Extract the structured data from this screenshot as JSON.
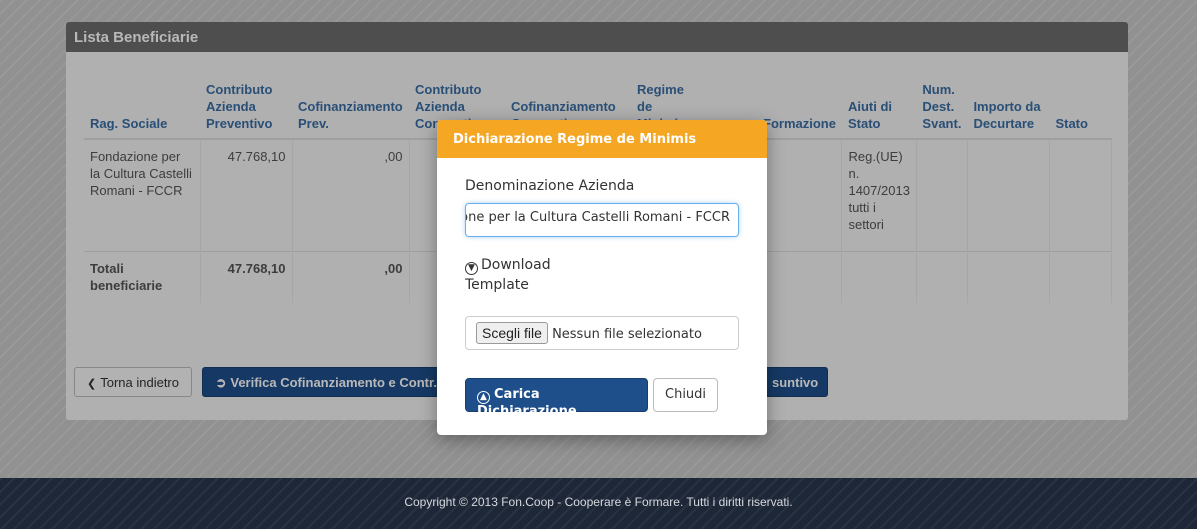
{
  "panel": {
    "title": "Lista Beneficiarie"
  },
  "table": {
    "columns": [
      "Rag. Sociale",
      "Contributo Azienda Preventivo",
      "Cofinanziamento Prev.",
      "Contributo Azienda Consuntivo",
      "Cofinanziamento Consuntivo",
      "Regime de Minimis",
      "",
      "Formazione",
      "Aiuti di Stato",
      "Num. Dest. Svant.",
      "Importo da Decurtare",
      "Stato"
    ],
    "row": {
      "rag_sociale": "Fondazione per la Cultura Castelli Romani - FCCR",
      "contributo": "47.768,10",
      "cofin": ",00",
      "aiuti": "Reg.(UE) n. 1407/2013 tutti i settori"
    },
    "totals": {
      "label": "Totali beneficiarie",
      "contributo": "47.768,10",
      "cofin": ",00"
    }
  },
  "buttons": {
    "back": "Torna indietro",
    "verify": "Verifica Cofinanziamento e Contr.",
    "consuntivo": "suntivo"
  },
  "modal": {
    "title": "Dichiarazione Regime de Minimis",
    "field_label": "Denominazione Azienda",
    "field_value": "Fondazione per la Cultura Castelli Romani - FCCR",
    "download_label": "Download",
    "template_label": "Template",
    "file_button": "Scegli file",
    "file_status": "Nessun file selezionato",
    "upload_button": "Carica Dichiarazione",
    "close_button": "Chiudi"
  },
  "footer": {
    "text": "Copyright © 2013 Fon.Coop - Cooperare è Formare. Tutti i diritti riservati."
  },
  "icons": {
    "back": "chevron-left-icon",
    "verify": "circle-arrow-icon",
    "download": "download-circle-icon",
    "upload": "upload-circle-icon"
  },
  "colors": {
    "modal_header": "#f5a623",
    "primary_button": "#1e4f8b",
    "panel_header": "#6d6d6d",
    "table_header_text": "#3b6ea5",
    "footer_bg": "#1e2737"
  }
}
